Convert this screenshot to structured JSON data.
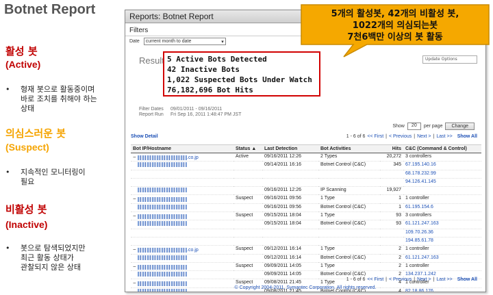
{
  "slide": {
    "title": "Botnet Report",
    "sections": [
      {
        "title": "활성 봇",
        "subtitle": "(Active)",
        "bullet": [
          "형재 봇으로 활동중이며",
          "바로 조치를 취해야 하는",
          "상태"
        ]
      },
      {
        "title": "의심스러운 봇",
        "subtitle": "(Suspect)",
        "bullet": [
          "지속적인 모니터링이",
          "필요"
        ]
      },
      {
        "title": "비활성 봇",
        "subtitle": "(Inactive)",
        "bullet": [
          "봇으로 탐색되었지만",
          "최근 활동 상태가",
          "관찰되지 않은 상태"
        ]
      }
    ]
  },
  "window": {
    "title": "Reports: Botnet Report",
    "filters_label": "Filters",
    "date_label": "Date",
    "date_value": "current month to date",
    "results_label": "Results",
    "update_label": "Update Options"
  },
  "stats": [
    "5 Active Bots Detected",
    "42 Inactive Bots",
    "1,022 Suspected Bots Under Watch",
    "76,182,696 Bot Hits"
  ],
  "filter_info": {
    "dates_label": "Filter Dates",
    "dates_value": "09/01/2011 - 09/16/2011",
    "run_label": "Report Run",
    "run_value": "Fri Sep 16, 2011 1:48:47 PM JST"
  },
  "controls": {
    "show_label": "Show",
    "show_value": "20",
    "per_page": "per page",
    "change": "Change",
    "show_detail": "Show Detail"
  },
  "pager": {
    "range": "1 - 6 of 6",
    "first": "<< First",
    "prev": "< Previous",
    "next": "Next >",
    "last": "Last >>",
    "show_all": "Show All"
  },
  "pager_bottom": {
    "range": "1 - 6 of 6",
    "first": "<< First",
    "prev": "< Previous",
    "next": "Next >",
    "last": "Last >>",
    "show_all": "Show All"
  },
  "table": {
    "headers": [
      "Bot IP/Hostname",
      "Status",
      "Last Detection",
      "Bot Activities",
      "Hits",
      "C&C (Command & Control)"
    ],
    "rows": [
      {
        "host": ".co.jp",
        "expand": "−",
        "status": "Active",
        "date": "09/16/2011 12:26",
        "activity": "2 Types",
        "hits": "20,272",
        "cc": "3 controllers",
        "cc_link": false
      },
      {
        "host": "",
        "expand": "",
        "status": "",
        "date": "09/14/2011 16:16",
        "activity": "Botnet Control (C&C)",
        "hits": "345",
        "cc": "67.195.140.16",
        "cc_link": true
      },
      {
        "host": "",
        "expand": "",
        "status": "",
        "date": "",
        "activity": "",
        "hits": "",
        "cc": "68.178.232.99",
        "cc_link": true
      },
      {
        "host": "",
        "expand": "",
        "status": "",
        "date": "",
        "activity": "",
        "hits": "",
        "cc": "94.126.41.145",
        "cc_link": true
      },
      {
        "host": "",
        "expand": "",
        "status": "",
        "date": "09/16/2011 12:26",
        "activity": "IP Scanning",
        "hits": "19,927",
        "cc": "",
        "cc_link": false
      },
      {
        "host": "",
        "expand": "−",
        "status": "Suspect",
        "date": "09/16/2011 09:56",
        "activity": "1 Type",
        "hits": "1",
        "cc": "1 controller",
        "cc_link": false
      },
      {
        "host": "",
        "expand": "",
        "status": "",
        "date": "09/16/2011 09:56",
        "activity": "Botnet Control (C&C)",
        "hits": "1",
        "cc": "61.195.154.6",
        "cc_link": true
      },
      {
        "host": "",
        "expand": "−",
        "status": "Suspect",
        "date": "09/15/2011 18:04",
        "activity": "1 Type",
        "hits": "93",
        "cc": "3 controllers",
        "cc_link": false
      },
      {
        "host": "",
        "expand": "",
        "status": "",
        "date": "09/15/2011 18:04",
        "activity": "Botnet Control (C&C)",
        "hits": "93",
        "cc": "61.121.247.163",
        "cc_link": true
      },
      {
        "host": "",
        "expand": "",
        "status": "",
        "date": "",
        "activity": "",
        "hits": "",
        "cc": "109.70.26.36",
        "cc_link": true
      },
      {
        "host": "",
        "expand": "",
        "status": "",
        "date": "",
        "activity": "",
        "hits": "",
        "cc": "194.85.61.78",
        "cc_link": true
      },
      {
        "host": ".co.jp",
        "expand": "−",
        "status": "Suspect",
        "date": "09/12/2011 16:14",
        "activity": "1 Type",
        "hits": "2",
        "cc": "1 controller",
        "cc_link": false
      },
      {
        "host": "",
        "expand": "",
        "status": "",
        "date": "09/12/2011 16:14",
        "activity": "Botnet Control (C&C)",
        "hits": "2",
        "cc": "61.121.247.163",
        "cc_link": true
      },
      {
        "host": "",
        "expand": "−",
        "status": "Suspect",
        "date": "09/09/2011 14:05",
        "activity": "1 Type",
        "hits": "2",
        "cc": "1 controller",
        "cc_link": false
      },
      {
        "host": "",
        "expand": "",
        "status": "",
        "date": "09/09/2011 14:05",
        "activity": "Botnet Control (C&C)",
        "hits": "2",
        "cc": "134.237.1.242",
        "cc_link": true
      },
      {
        "host": "",
        "expand": "−",
        "status": "Suspect",
        "date": "09/08/2011 21:45",
        "activity": "1 Type",
        "hits": "4",
        "cc": "1 controller",
        "cc_link": false
      },
      {
        "host": "",
        "expand": "",
        "status": "",
        "date": "09/08/2011 21:45",
        "activity": "Botnet Control (C&C)",
        "hits": "4",
        "cc": "82.18.86.176",
        "cc_link": true
      }
    ]
  },
  "footer": "© Copyright 2004-2011, Symantec Corporation. All rights reserved.",
  "callout": {
    "lines": [
      "5개의 활성봇, 42개의 비활성 봇,",
      "1022개의 의심되는봇",
      "7천6백만 이상의 봇 활동"
    ],
    "fill": "#f5a800"
  }
}
